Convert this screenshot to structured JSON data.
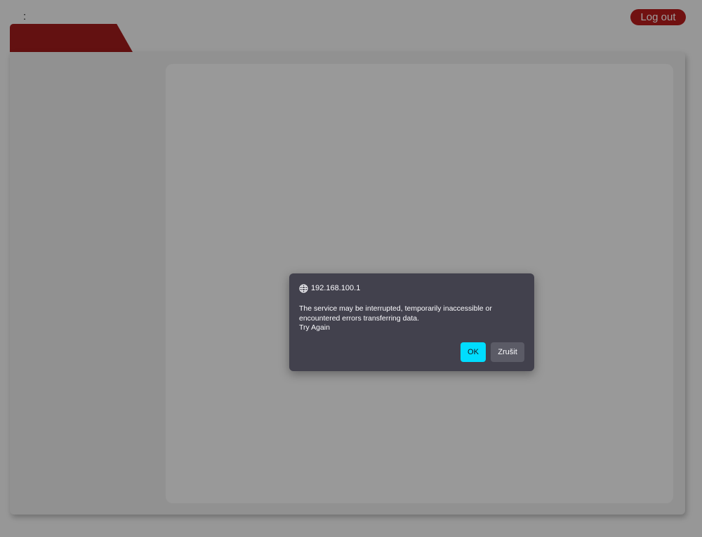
{
  "header": {
    "colon_text": ":",
    "logout_label": "Log out"
  },
  "colors": {
    "accent_red": "#b71c1c",
    "tab_red": "#a01c1c",
    "dialog_bg": "#42414d",
    "ok_button": "#00ddff",
    "cancel_button": "#5b5b66"
  },
  "dialog": {
    "icon": "globe-icon",
    "origin": "192.168.100.1",
    "message_lines": [
      "The service may be interrupted, temporarily inaccessible or",
      "encountered errors transferring data.",
      "Try Again"
    ],
    "ok_label": "OK",
    "cancel_label": "Zrušit"
  }
}
